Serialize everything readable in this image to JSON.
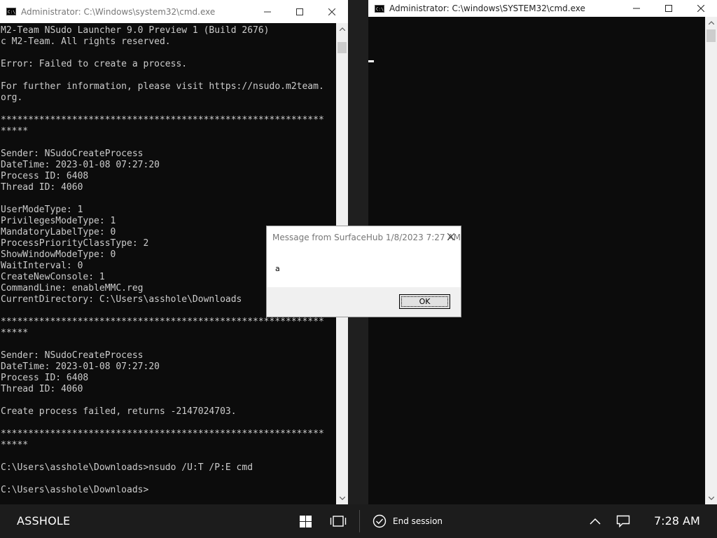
{
  "left_window": {
    "title": "Administrator: C:\\Windows\\system32\\cmd.exe",
    "console_lines": [
      "M2-Team NSudo Launcher 9.0 Preview 1 (Build 2676)",
      "c M2-Team. All rights reserved.",
      "",
      "Error: Failed to create a process.",
      "",
      "For further information, please visit https://nsudo.m2team.",
      "org.",
      "",
      "***********************************************************",
      "*****",
      "",
      "Sender: NSudoCreateProcess",
      "DateTime: 2023-01-08 07:27:20",
      "Process ID: 6408",
      "Thread ID: 4060",
      "",
      "UserModeType: 1",
      "PrivilegesModeType: 1",
      "MandatoryLabelType: 0",
      "ProcessPriorityClassType: 2",
      "ShowWindowModeType: 0",
      "WaitInterval: 0",
      "CreateNewConsole: 1",
      "CommandLine: enableMMC.reg",
      "CurrentDirectory: C:\\Users\\asshole\\Downloads",
      "",
      "***********************************************************",
      "*****",
      "",
      "Sender: NSudoCreateProcess",
      "DateTime: 2023-01-08 07:27:20",
      "Process ID: 6408",
      "Thread ID: 4060",
      "",
      "Create process failed, returns -2147024703.",
      "",
      "***********************************************************",
      "*****",
      "",
      "C:\\Users\\asshole\\Downloads>nsudo /U:T /P:E cmd",
      "",
      "C:\\Users\\asshole\\Downloads>"
    ]
  },
  "right_window": {
    "title": "Administrator: C:\\windows\\SYSTEM32\\cmd.exe",
    "console_text": ""
  },
  "dialog": {
    "title": "Message from SurfaceHub 1/8/2023 7:27 AM",
    "message": "a",
    "ok_label": "OK"
  },
  "taskbar": {
    "user": "ASSHOLE",
    "end_session_label": "End session",
    "time": "7:28 AM"
  },
  "icons": {
    "windows": "windows-logo-icon",
    "task_view": "task-view-icon",
    "end_session": "checkmark-circle-icon",
    "show_hidden": "chevron-up-icon",
    "notifications": "action-center-icon"
  }
}
